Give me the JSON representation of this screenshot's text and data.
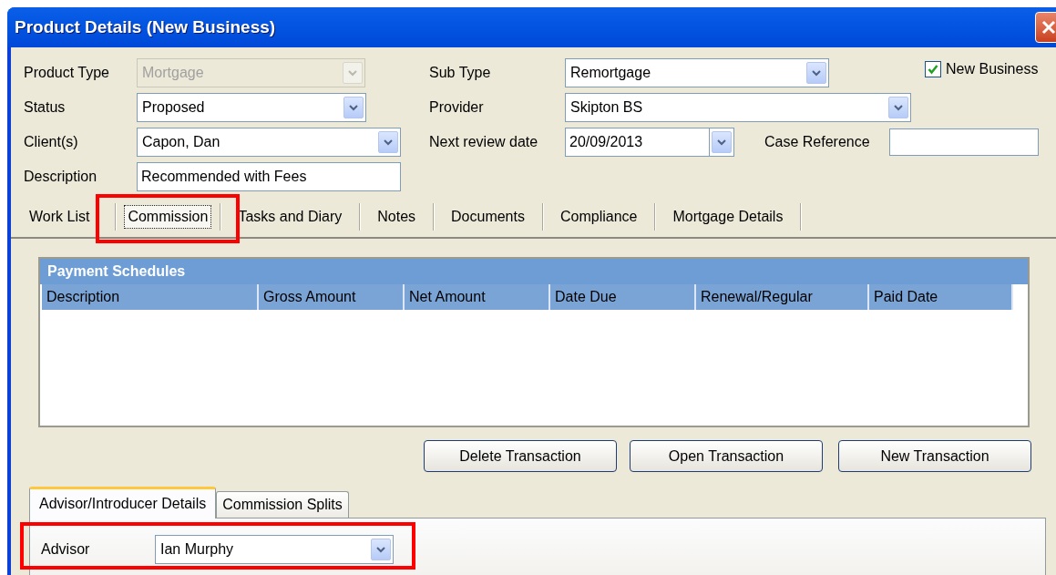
{
  "window": {
    "title": "Product Details (New Business)"
  },
  "form": {
    "product_type": {
      "label": "Product Type",
      "value": "Mortgage",
      "disabled": true
    },
    "sub_type": {
      "label": "Sub Type",
      "value": "Remortgage",
      "disabled": false
    },
    "new_business": {
      "label": "New Business",
      "checked": true
    },
    "status": {
      "label": "Status",
      "value": "Proposed",
      "disabled": false
    },
    "provider": {
      "label": "Provider",
      "value": "Skipton BS",
      "disabled": false
    },
    "clients": {
      "label": "Client(s)",
      "value": "Capon, Dan",
      "disabled": false
    },
    "next_review_date": {
      "label": "Next review date",
      "value": "20/09/2013"
    },
    "case_reference": {
      "label": "Case Reference"
    },
    "description": {
      "label": "Description",
      "value": "Recommended with Fees"
    }
  },
  "tabs": [
    {
      "label": "Work List",
      "selected": false
    },
    {
      "label": "Commission",
      "selected": true
    },
    {
      "label": "Tasks and Diary",
      "selected": false
    },
    {
      "label": "Notes",
      "selected": false
    },
    {
      "label": "Documents",
      "selected": false
    },
    {
      "label": "Compliance",
      "selected": false
    },
    {
      "label": "Mortgage Details",
      "selected": false
    }
  ],
  "payment_schedules": {
    "title": "Payment Schedules",
    "columns": [
      "Description",
      "Gross Amount",
      "Net Amount",
      "Date Due",
      "Renewal/Regular",
      "Paid Date"
    ]
  },
  "buttons": [
    "Delete Transaction",
    "Open Transaction",
    "New Transaction"
  ],
  "sub_tabs": [
    {
      "label": "Advisor/Introducer Details",
      "selected": true
    },
    {
      "label": "Commission Splits",
      "selected": false
    }
  ],
  "advisor": {
    "label": "Advisor",
    "value": "Ian Murphy",
    "disabled": false
  }
}
